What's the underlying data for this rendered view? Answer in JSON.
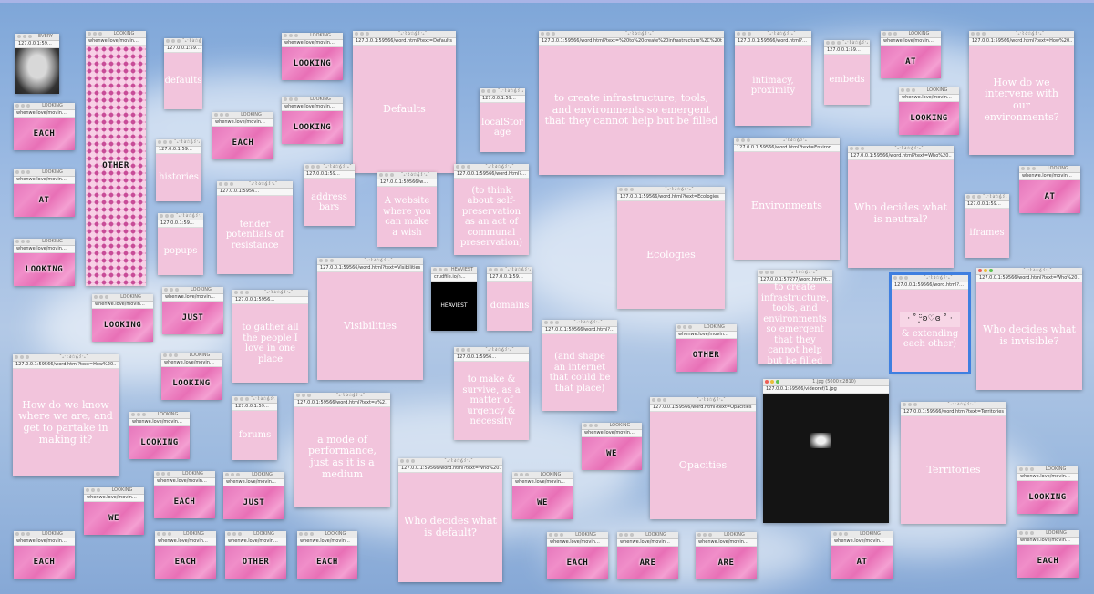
{
  "desktop": {
    "background": "sky-with-clouds"
  },
  "url": {
    "gif": "whenwe.love/movin…",
    "w59": "127.0.0.1:59…",
    "w5956": "127.0.0.1:5956…",
    "w59566": "127.0.0.1:59566/word.html?…",
    "medium": "127.0.0.1:59566/word.html?text=…",
    "defaults": "127.0.0.1:59566/word.html?text=Defaults",
    "infra": "127.0.0.1:59566/word.html?text=%20to%20create%20infrastructure%2C%20tools…",
    "environ": "127.0.0.1:59566/word.html?text=Environ…",
    "whoNeutral": "127.0.0.1:59566/word.html?text=Who%20…",
    "ecologies": "127.0.0.1:59566/word.html?text=Ecologies",
    "visibilities": "127.0.0.1:59566/word.html?text=Visibilities",
    "heaviest": "crudfile.io/n…",
    "whoInvisible": "127.0.0.1:59566/word.html?text=Who%20…",
    "howWeKnow": "127.0.0.1:59566/word.html?text=How%20…",
    "howIntervene": "127.0.0.1:59566/word.html?text=How%20…",
    "perf": "127.0.0.1:59566/word.html?text=a%2…",
    "infra2": "127.0.0.1:57277/word.html?t…",
    "extending": "127.0.0.1:59566/word.html?…",
    "opacities": "127.0.0.1:59566/word.html?text=Opacities",
    "video": "127.0.0.1:59566/videoref/1.jpg",
    "territories": "127.0.0.1:59566/word.html?text=Territories",
    "whoDefault": "127.0.0.1:59566/word.html?text=Who%20…",
    "every": "127.0.0.1:59…",
    "word": "127.0.0.1:59566/w…"
  },
  "titles": {
    "looking": "LOOKING",
    "kao": "˚₊‧꒰ა☆໒꒱‧₊˚",
    "every": "EVERY",
    "heaviest": "HEAVIEST",
    "video": "1.jpg (5000×2810)"
  },
  "words": {
    "each": "EACH",
    "at": "AT",
    "looking": "LOOKING",
    "other": "OTHER",
    "just": "JUST",
    "we": "WE",
    "are": "ARE"
  },
  "texts": {
    "defaults_small": "defaults",
    "defaults": "Defaults",
    "infra": "to create infrastructure, tools, and environments so emergent that they cannot help but be filled",
    "intimacy": "intimacy, proximity",
    "embeds": "embeds",
    "howIntervene": "How do we intervene with our environments?",
    "localStorage": "localStor age",
    "histories": "histories",
    "address": "address bars",
    "wish": "A website where you can make a wish",
    "selfPres": "(to think about self-preservation as an act of communal preservation)",
    "tender": "tender potentials of resistance",
    "popups": "popups",
    "ecologies": "Ecologies",
    "environments": "Environments",
    "whoNeutral": "Who decides what is neutral?",
    "iframes": "iframes",
    "visibilities": "Visibilities",
    "heaviest": "HEAVIEST",
    "domains": "domains",
    "gather": "to gather all the people I love in one place",
    "infra2": "to create infrastructure, tools, and environments so emergent that they cannot help but be filled",
    "extending": "& extending each other)",
    "extending_kao": "· ˚ ͙ᵕ̈ʚ♡ɞ ˚ ·",
    "whoInvisible": "Who decides what is invisible?",
    "howWeKnow": "How do we know where we are, and get to partake in making it?",
    "shape": "(and shape an internet that could be that place)",
    "survive": "to make & survive, as a matter of urgency & necessity",
    "forums": "forums",
    "perf": "a mode of performance, just as it is a medium",
    "opacities": "Opacities",
    "territories": "Territories",
    "whoDefault": "Who decides what is default?"
  }
}
